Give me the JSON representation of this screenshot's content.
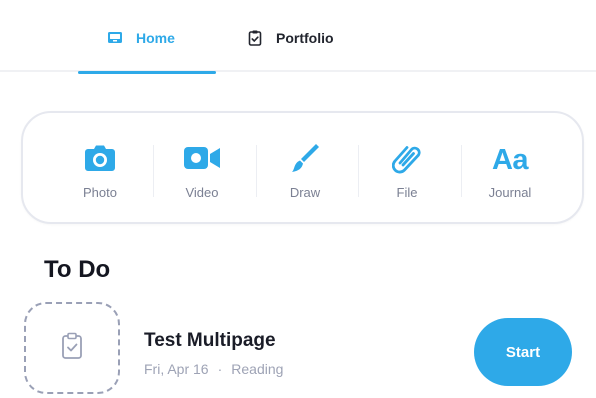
{
  "tabs": {
    "home": {
      "label": "Home",
      "icon": "home-tray-icon",
      "active": true
    },
    "portfolio": {
      "label": "Portfolio",
      "icon": "clipboard-check-icon",
      "active": false
    }
  },
  "actions": [
    {
      "label": "Photo",
      "icon": "camera-icon"
    },
    {
      "label": "Video",
      "icon": "video-camera-icon"
    },
    {
      "label": "Draw",
      "icon": "paintbrush-icon"
    },
    {
      "label": "File",
      "icon": "paperclip-icon"
    },
    {
      "label": "Journal",
      "icon": "journal-aa-icon",
      "glyph": "Aa"
    }
  ],
  "todo": {
    "title": "To Do",
    "tasks": [
      {
        "name": "Test Multipage",
        "date": "Fri, Apr 16",
        "separator": "·",
        "category": "Reading",
        "icon": "clipboard-check-icon",
        "start_label": "Start"
      }
    ]
  },
  "colors": {
    "accent": "#2ea9e8",
    "text_dark": "#1a1c27",
    "text_muted": "#9ea3b5",
    "border": "#e6e8ef"
  }
}
